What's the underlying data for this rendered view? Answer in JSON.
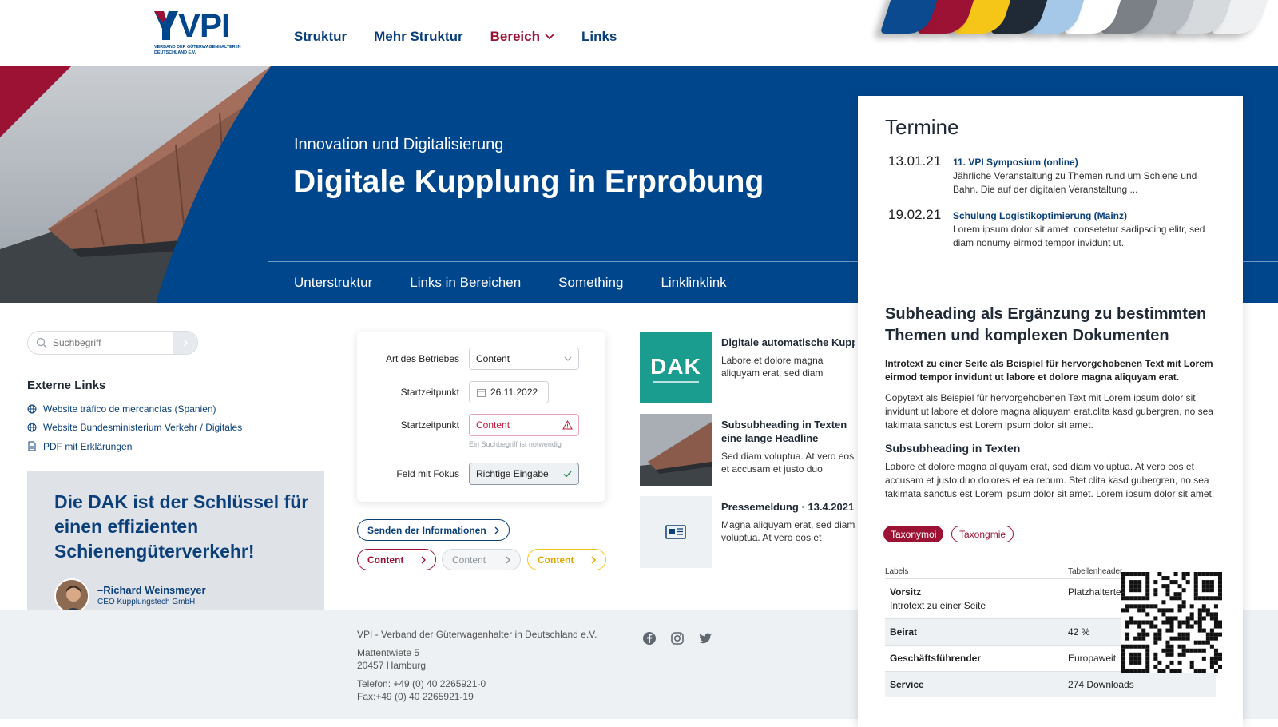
{
  "header": {
    "logo_text": "VPI",
    "logo_sub": "Verband der Güterwagenhalter in Deutschland e.V.",
    "nav": [
      {
        "label": "Struktur"
      },
      {
        "label": "Mehr Struktur"
      },
      {
        "label": "Bereich"
      },
      {
        "label": "Links"
      }
    ],
    "swatch_colors": [
      "#0b4a8f",
      "#9b1234",
      "#f5c518",
      "#1f2a36",
      "#a6c8e8",
      "#ffffff",
      "#7b8087",
      "#b6bbc1",
      "#d7dadd",
      "#eef0f2"
    ]
  },
  "hero": {
    "kicker": "Innovation und Digitalisierung",
    "title": "Digitale Kupplung in Erprobung",
    "subnav": [
      "Unterstruktur",
      "Links in Bereichen",
      "Something",
      "Linklinklink"
    ]
  },
  "search": {
    "placeholder": "Suchbegriff"
  },
  "external_links": {
    "title": "Externe Links",
    "items": [
      {
        "label": "Website tráfico de mercancías (Spanien)",
        "icon": "globe-icon"
      },
      {
        "label": "Website Bundesministerium Verkehr / Digitales",
        "icon": "globe-icon"
      },
      {
        "label": "PDF mit Erklärungen",
        "icon": "pdf-icon"
      }
    ]
  },
  "quote": {
    "text": "Die DAK ist der Schlüssel für einen effizienten Schienengüterverkehr!",
    "name": "–Richard Weinsmeyer",
    "role": "CEO Kupplungstech GmbH"
  },
  "form": {
    "fields": [
      {
        "label": "Art des Betriebes",
        "value": "Content"
      },
      {
        "label": "Startzeitpunkt",
        "value": "26.11.2022"
      },
      {
        "label": "Startzeitpunkt",
        "value": "Content"
      },
      {
        "label": "Feld mit Fokus",
        "value": "Richtige Eingabe"
      }
    ],
    "error_hint": "Ein Suchbegriff ist notwendig",
    "submit_label": "Senden der Informationen",
    "buttons": [
      "Content",
      "Content",
      "Content"
    ]
  },
  "news": [
    {
      "title": "Digitale automatische Kupplung",
      "text": "Labore et dolore magna aliquyam erat, sed diam voluptua. At vero eos et accusam"
    },
    {
      "title": "Subsubheading in Texten eine lange Headline",
      "text": "Sed diam voluptua. At vero eos et accusam et justo duo dolores et ea rebum"
    },
    {
      "title": "Pressemeldung · 13.4.2021",
      "text": "Magna aliquyam erat, sed diam voluptua. At vero eos et accusam et justo"
    }
  ],
  "news_logo": "DAK",
  "footer": {
    "org": "VPI - Verband der Güterwagenhalter in Deutschland e.V.",
    "street": "Mattentwiete 5",
    "city": "20457 Hamburg",
    "phone": "Telefon: +49 (0) 40 2265921-0",
    "fax": "Fax:+49 (0) 40 2265921-19"
  },
  "panel": {
    "termine_title": "Termine",
    "events": [
      {
        "date": "13.01.21",
        "title": "11. VPI Symposium (online)",
        "text": "Jährliche Veranstaltung zu Themen rund um Schiene und Bahn. Die auf der digitalen Veranstaltung ..."
      },
      {
        "date": "19.02.21",
        "title": "Schulung Logistikoptimierung (Mainz)",
        "text": "Lorem ipsum dolor sit amet, consetetur sadipscing elitr, sed diam nonumy eirmod tempor invidunt ut."
      }
    ],
    "subheading": "Subheading als Ergänzung zu bestimmten Themen und komplexen Dokumenten",
    "intro": "Introtext zu einer Seite als Beispiel für hervorgehobenen Text mit Lorem eirmod tempor invidunt ut labore et dolore magna aliquyam erat.",
    "copy": "Copytext als Beispiel für hervorgehobenen Text mit Lorem ipsum dolor sit invidunt ut labore et dolore magna aliquyam erat.clita kasd gubergren, no sea takimata sanctus est Lorem ipsum dolor sit amet.",
    "subsub": "Subsubheading in Texten",
    "copy2": "Labore et dolore magna aliquyam erat, sed diam voluptua. At vero eos et accusam et justo duo dolores et ea rebum. Stet clita kasd gubergren, no sea takimata sanctus est Lorem ipsum dolor sit amet. Lorem ipsum dolor sit amet.",
    "tags": [
      "Taxonymoi",
      "Taxongmie"
    ],
    "table": {
      "head_labels": "Labels",
      "head_values": "Tabellenheader",
      "rows": [
        {
          "key": "Vorsitz",
          "sub": "Introtext zu einer Seite",
          "value": "Platzhaltertext"
        },
        {
          "key": "Beirat",
          "value": "42 %"
        },
        {
          "key": "Geschäftsführender",
          "value": "Europaweit"
        },
        {
          "key": "Service",
          "value": "274 Downloads"
        }
      ]
    }
  },
  "colors": {
    "brand_blue": "#00468c",
    "brand_red": "#9b1234",
    "accent_yellow": "#f5c518"
  }
}
